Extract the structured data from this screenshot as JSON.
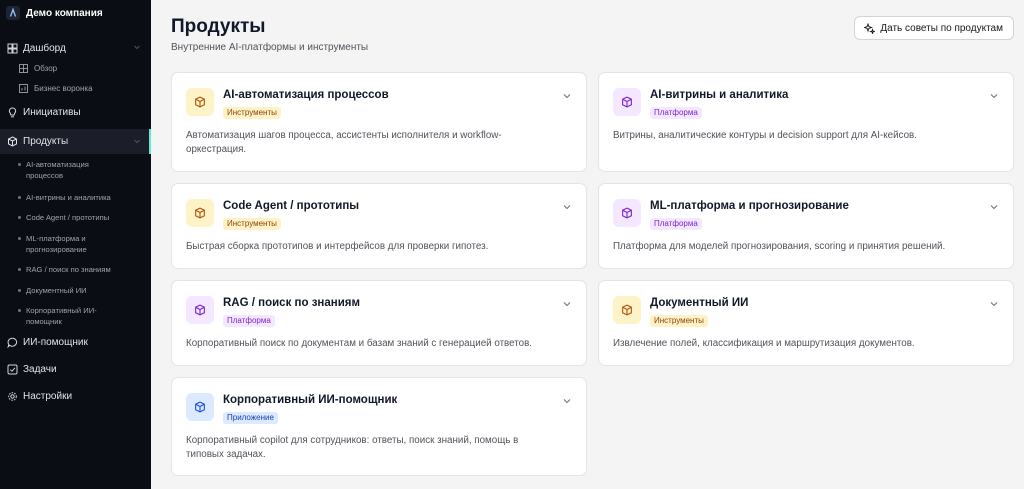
{
  "sidebar": {
    "company": "Демо компания",
    "items": [
      {
        "label": "Дашборд",
        "icon": "dashboard-icon"
      },
      {
        "label": "Инициативы",
        "icon": "lightbulb-icon"
      },
      {
        "label": "Продукты",
        "icon": "box-icon"
      },
      {
        "label": "ИИ-помощник",
        "icon": "chat-icon"
      },
      {
        "label": "Задачи",
        "icon": "checkbox-icon"
      },
      {
        "label": "Настройки",
        "icon": "gear-icon"
      }
    ],
    "dashboard_sub": [
      {
        "label": "Обзор",
        "icon": "grid-icon"
      },
      {
        "label": "Бизнес воронка",
        "icon": "bars-icon"
      }
    ],
    "products_sub": [
      "AI-автоматизация процессов",
      "AI-витрины и аналитика",
      "Code Agent / прототипы",
      "ML-платформа и прогнозирование",
      "RAG / поиск по знаниям",
      "Документный ИИ",
      "Корпоративный ИИ-помощник"
    ]
  },
  "header": {
    "title": "Продукты",
    "subtitle": "Внутренние AI-платформы и инструменты",
    "advice_button": "Дать советы по продуктам"
  },
  "products": [
    {
      "title": "AI-автоматизация процессов",
      "badge": "Инструменты",
      "description": "Автоматизация шагов процесса, ассистенты исполнителя и workflow-оркестрация."
    },
    {
      "title": "AI-витрины и аналитика",
      "badge": "Платформа",
      "description": "Витрины, аналитические контуры и decision support для AI-кейсов."
    },
    {
      "title": "Code Agent / прототипы",
      "badge": "Инструменты",
      "description": "Быстрая сборка прототипов и интерфейсов для проверки гипотез."
    },
    {
      "title": "ML-платформа и прогнозирование",
      "badge": "Платформа",
      "description": "Платформа для моделей прогнозирования, scoring и принятия решений."
    },
    {
      "title": "RAG / поиск по знаниям",
      "badge": "Платформа",
      "description": "Корпоративный поиск по документам и базам знаний с генерацией ответов."
    },
    {
      "title": "Документный ИИ",
      "badge": "Инструменты",
      "description": "Извлечение полей, классификация и маршрутизация документов."
    },
    {
      "title": "Корпоративный ИИ-помощник",
      "badge": "Приложение",
      "description": "Корпоративный copilot для сотрудников: ответы, поиск знаний, помощь в типовых задачах."
    }
  ],
  "colors": {
    "sidebar_bg": "#0b0d14",
    "active_accent": "#5eead4",
    "tools_badge": "#fef3c7",
    "platform_badge": "#f3e8ff",
    "app_badge": "#dbeafe"
  }
}
